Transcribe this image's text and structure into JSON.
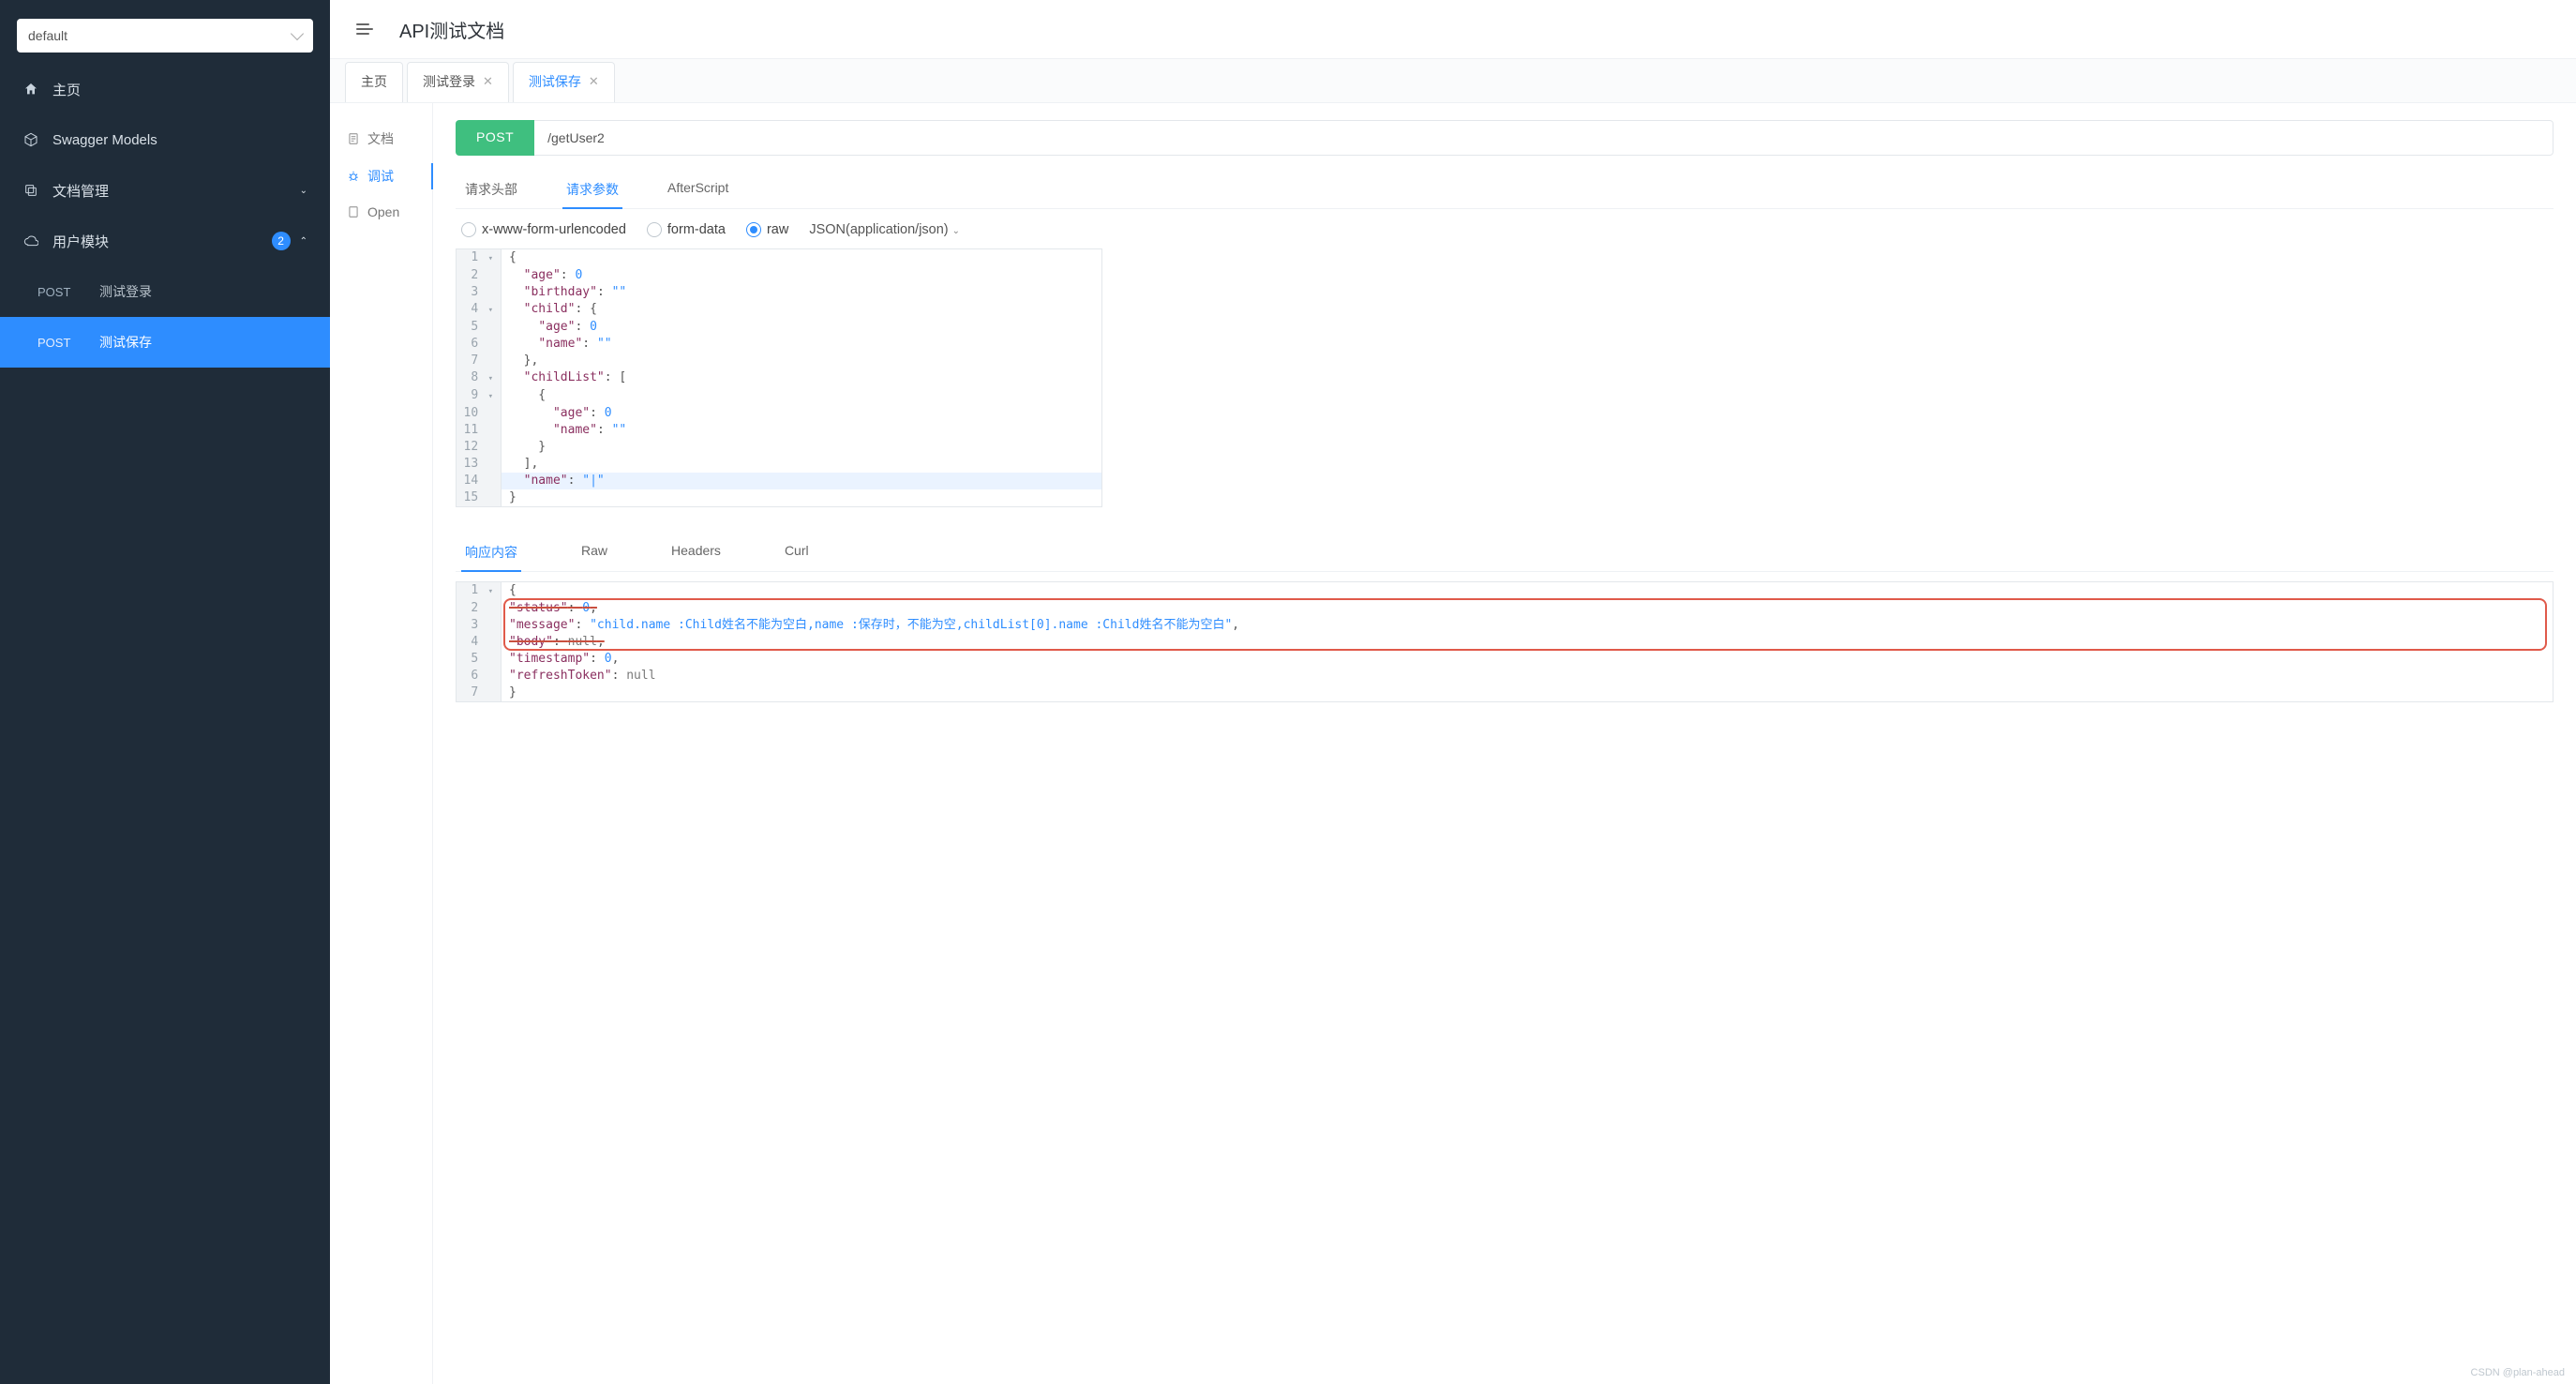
{
  "projectSelect": {
    "value": "default"
  },
  "nav": {
    "home": "主页",
    "models": "Swagger Models",
    "docsMgr": "文档管理",
    "userModule": "用户模块",
    "userModuleBadge": "2",
    "items": [
      {
        "method": "POST",
        "label": "测试登录"
      },
      {
        "method": "POST",
        "label": "测试保存"
      }
    ]
  },
  "header": {
    "title": "API测试文档"
  },
  "tabs": [
    {
      "label": "主页",
      "closable": false,
      "active": false
    },
    {
      "label": "测试登录",
      "closable": true,
      "active": false
    },
    {
      "label": "测试保存",
      "closable": true,
      "active": true
    }
  ],
  "innerSide": {
    "doc": "文档",
    "debug": "调试",
    "open": "Open"
  },
  "request": {
    "method": "POST",
    "url": "/getUser2"
  },
  "subtabs": {
    "headers": "请求头部",
    "params": "请求参数",
    "after": "AfterScript"
  },
  "bodyTypes": {
    "form": "x-www-form-urlencoded",
    "formdata": "form-data",
    "raw": "raw",
    "contentType": "JSON(application/json)"
  },
  "reqEditor": [
    {
      "n": "1",
      "fold": "▾",
      "text": "{"
    },
    {
      "n": "2",
      "text": "  \"age\": 0,",
      "k": "age",
      "v": "0",
      "t": "num"
    },
    {
      "n": "3",
      "text": "  \"birthday\": \"\",",
      "k": "birthday",
      "v": "\"\"",
      "t": "str"
    },
    {
      "n": "4",
      "fold": "▾",
      "text": "  \"child\": {",
      "k": "child",
      "open": "{"
    },
    {
      "n": "5",
      "text": "    \"age\": 0,",
      "k": "age",
      "v": "0",
      "t": "num"
    },
    {
      "n": "6",
      "text": "    \"name\": \"\"",
      "k": "name",
      "v": "\"\"",
      "t": "str"
    },
    {
      "n": "7",
      "text": "  },"
    },
    {
      "n": "8",
      "fold": "▾",
      "text": "  \"childList\": [",
      "k": "childList",
      "open": "["
    },
    {
      "n": "9",
      "fold": "▾",
      "text": "    {"
    },
    {
      "n": "10",
      "text": "      \"age\": 0,",
      "k": "age",
      "v": "0",
      "t": "num"
    },
    {
      "n": "11",
      "text": "      \"name\": \"\"",
      "k": "name",
      "v": "\"\"",
      "t": "str"
    },
    {
      "n": "12",
      "text": "    }"
    },
    {
      "n": "13",
      "text": "  ],"
    },
    {
      "n": "14",
      "hl": true,
      "text": "  \"name\": \"|\"",
      "k": "name",
      "v": "\"|\"",
      "t": "str"
    },
    {
      "n": "15",
      "text": "}"
    }
  ],
  "respTabs": {
    "content": "响应内容",
    "raw": "Raw",
    "headers": "Headers",
    "curl": "Curl"
  },
  "respEditor": [
    {
      "n": "1",
      "fold": "▾",
      "text": "{"
    },
    {
      "n": "2",
      "strike": true,
      "k": "status",
      "v": "0",
      "t": "num",
      "comma": true
    },
    {
      "n": "3",
      "k": "message",
      "v": "\"child.name :Child姓名不能为空白,name :保存时，不能为空,childList[0].name :Child姓名不能为空白\"",
      "t": "str",
      "comma": true
    },
    {
      "n": "4",
      "strike": true,
      "k": "body",
      "v": "null",
      "t": "null",
      "comma": true
    },
    {
      "n": "5",
      "k": "timestamp",
      "v": "0",
      "t": "num",
      "comma": true
    },
    {
      "n": "6",
      "k": "refreshToken",
      "v": "null",
      "t": "null"
    },
    {
      "n": "7",
      "text": "}"
    }
  ],
  "watermark": "CSDN @plan-ahead"
}
